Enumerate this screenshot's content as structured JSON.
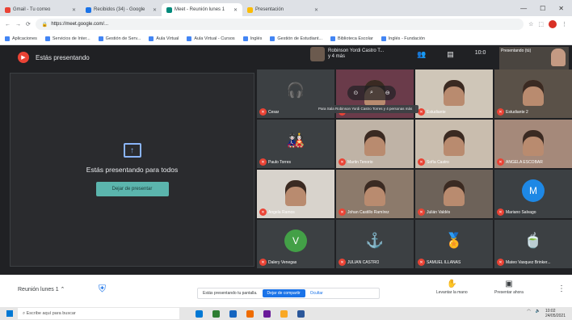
{
  "browser": {
    "tabs": [
      {
        "label": "Gmail - Tu correo",
        "color": "#ea4335",
        "active": false
      },
      {
        "label": "Recibidos (34) - Google",
        "color": "#1a73e8",
        "active": false
      },
      {
        "label": "Meet - Reunión lunes 1",
        "color": "#00897b",
        "active": true
      },
      {
        "label": "Presentación",
        "color": "#fbbc04",
        "active": false
      }
    ],
    "url": "https://meet.google.com/...",
    "bookmarks": [
      "Aplicaciones",
      "Servicios de Inter...",
      "Gestión de Serv...",
      "Aula Virtual",
      "Aula Virtual - Cursos",
      "Inglés",
      "Gestión de Estudiant...",
      "Biblioteca Escolar",
      "Inglés - Fundación"
    ]
  },
  "meet": {
    "presenting_title": "Estás presentando",
    "presenting_icon": "present-icon",
    "presenting_panel_text": "Estás presentando para todos",
    "stop_button_label": "Dejar de presentar",
    "speaker_name": "Robinson Yordi Castro T...",
    "speaker_sub": "y 4 más",
    "self_view_label": "Presentando (tú)",
    "tooltip": "Para Sala Robinson Yordi Castro Torres y 4 personas más",
    "participants": [
      {
        "name": "Cesar",
        "kind": "glyph",
        "glyph": "🎧",
        "bg": "#3c4043"
      },
      {
        "name": "",
        "kind": "photo",
        "bg": "#6a3b4a"
      },
      {
        "name": "Estudiante",
        "kind": "photo",
        "bg": "#cfc6b8"
      },
      {
        "name": "Estudiante 2",
        "kind": "photo",
        "bg": "#5a5148"
      },
      {
        "name": "Paulo Torres",
        "kind": "glyph",
        "glyph": "🎎",
        "bg": "#3c4043"
      },
      {
        "name": "Martin Tenorio",
        "kind": "photo",
        "bg": "#bfb3a6"
      },
      {
        "name": "Sofía Castro",
        "kind": "photo",
        "bg": "#c9bdae"
      },
      {
        "name": "ANGELA ESCOBAR",
        "kind": "photo",
        "bg": "#a5897a"
      },
      {
        "name": "Angela Ramos",
        "kind": "photo",
        "bg": "#d8d3cc"
      },
      {
        "name": "Johan Castillo Ramírez",
        "kind": "photo",
        "bg": "#8c7a6b"
      },
      {
        "name": "Julián Valdés",
        "kind": "photo",
        "bg": "#6d6259"
      },
      {
        "name": "Mariano Salvago",
        "kind": "avatar",
        "letter": "M",
        "bg": "#3c4043",
        "color": "#1e88e5"
      },
      {
        "name": "Dalery Venegas",
        "kind": "avatar",
        "letter": "V",
        "bg": "#3c4043",
        "color": "#43a047"
      },
      {
        "name": "JULIAN CASTRO",
        "kind": "glyph",
        "glyph": "⚓",
        "bg": "#3c4043"
      },
      {
        "name": "SAMUEL ILLANAS",
        "kind": "glyph",
        "glyph": "🏅",
        "bg": "#3c4043"
      },
      {
        "name": "Mateo Vasquez Brinker...",
        "kind": "glyph",
        "glyph": "🍵",
        "bg": "#3c4043"
      }
    ]
  },
  "bottom": {
    "meeting_name": "Reunión lunes 1",
    "notice": "Estás presentando tu pantalla.",
    "notice_stop": "Dejar de compartir",
    "notice_hide": "Ocultar",
    "raise_hand": "Levantar la mano",
    "present_now": "Presentar ahora"
  },
  "taskbar": {
    "search_placeholder": "Escribe aquí para buscar",
    "apps": [
      "#0078d4",
      "#2e7d32",
      "#1565c0",
      "#ef6c00",
      "#6a1b9a",
      "#f9a825",
      "#2b579a"
    ],
    "time": "10:02",
    "date": "24/05/2021"
  }
}
